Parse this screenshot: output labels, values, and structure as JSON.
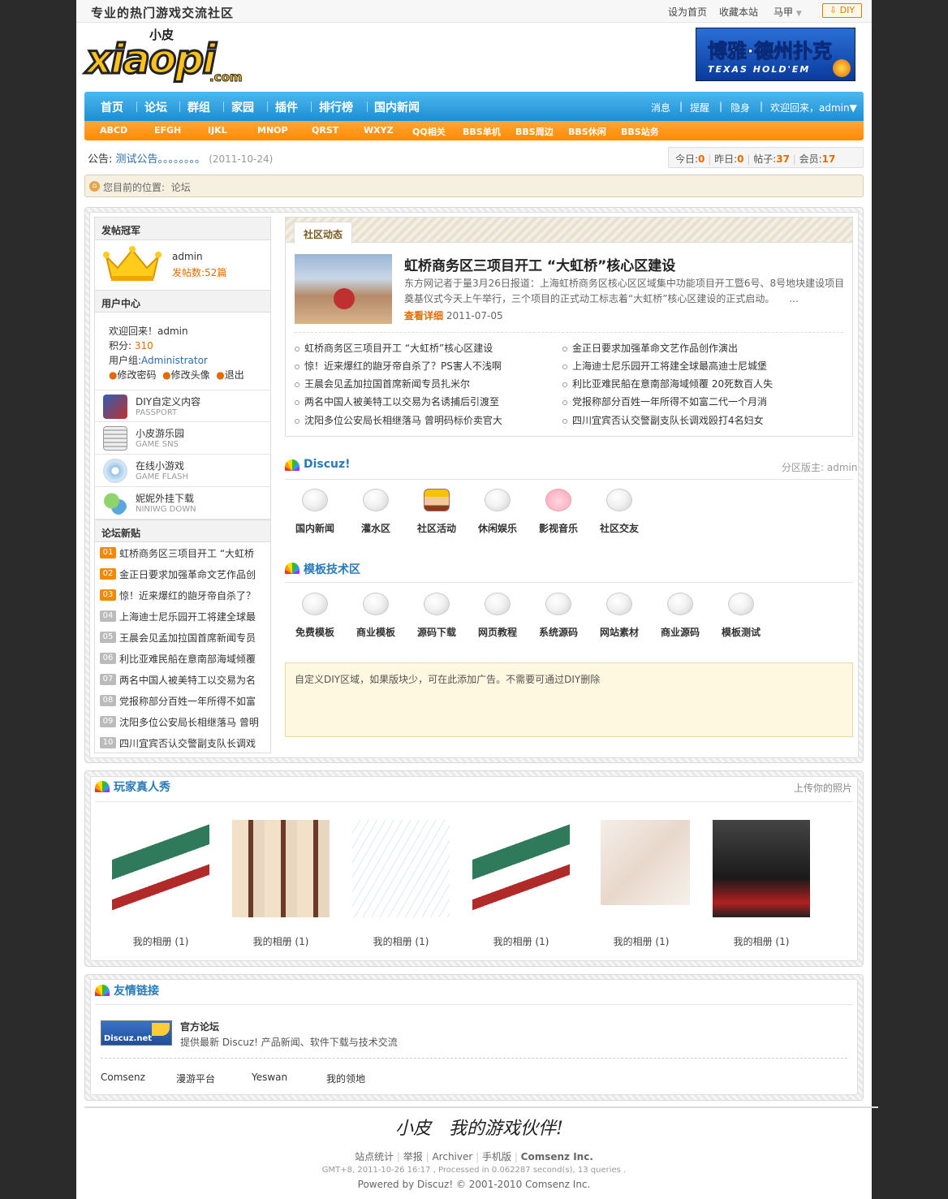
{
  "topbar": {
    "slogan": "专业的热门游戏交流社区",
    "set_home": "设为首页",
    "bookmark": "收藏本站",
    "user": "马甲",
    "diy": "DIY"
  },
  "logo": {
    "text_cn": "小皮",
    "text": "xiaopi",
    "dotcom": ".com"
  },
  "banner": {
    "title": "博雅·德州扑克",
    "sub": "TEXAS HOLD'EM"
  },
  "nav": {
    "items": [
      "首页",
      "论坛",
      "群组",
      "家园",
      "插件",
      "排行榜",
      "国内新闻"
    ],
    "right": [
      "消息",
      "提醒",
      "隐身",
      "欢迎回来，admin▼"
    ]
  },
  "subnav": [
    "ABCD",
    "EFGH",
    "IJKL",
    "MNOP",
    "QRST",
    "WXYZ",
    "QQ相关",
    "BBS单机",
    "BBS周边",
    "BBS休闲",
    "BBS站务"
  ],
  "notice": {
    "label": "公告:",
    "text": "测试公告。。。。。。。。",
    "date": "(2011-10-24)"
  },
  "stats": {
    "today_label": "今日:",
    "today": "0",
    "yesterday_label": "昨日:",
    "yesterday": "0",
    "posts_label": "帖子:",
    "posts": "37",
    "members_label": "会员:",
    "members": "17"
  },
  "breadcrumb": {
    "text": "您目前的位置:",
    "current": "论坛"
  },
  "sidebar": {
    "champion_title": "发帖冠军",
    "champion_name": "admin",
    "champion_count": "发帖数:52篇",
    "usercenter_title": "用户中心",
    "welcome": "欢迎回来！admin",
    "points_label": "积分:",
    "points": "310",
    "group_label": "用户组:",
    "group": "Administrator",
    "links": [
      "修改密码",
      "修改头像",
      "退出"
    ],
    "apps": [
      {
        "title": "DIY自定义内容",
        "sub": "PASSPORT"
      },
      {
        "title": "小皮游乐园",
        "sub": "GAME SNS"
      },
      {
        "title": "在线小游戏",
        "sub": "GAME FLASH"
      },
      {
        "title": "妮妮外挂下载",
        "sub": "NINIWG DOWN"
      }
    ],
    "newposts_title": "论坛新贴",
    "posts": [
      {
        "num": "01",
        "title": "虹桥商务区三项目开工 “大虹桥"
      },
      {
        "num": "02",
        "title": "金正日要求加强革命文艺作品创"
      },
      {
        "num": "03",
        "title": "惊！近来爆红的龅牙帝自杀了？"
      },
      {
        "num": "04",
        "title": "上海迪士尼乐园开工将建全球最"
      },
      {
        "num": "05",
        "title": "王晨会见孟加拉国首席新闻专员"
      },
      {
        "num": "06",
        "title": "利比亚难民船在意南部海域倾覆"
      },
      {
        "num": "07",
        "title": "两名中国人被美特工以交易为名"
      },
      {
        "num": "08",
        "title": "党报称部分百姓一年所得不如富"
      },
      {
        "num": "09",
        "title": "沈阳多位公安局长相继落马 曾明"
      },
      {
        "num": "10",
        "title": "四川宜宾否认交警副支队长调戏"
      }
    ]
  },
  "community": {
    "tab": "社区动态",
    "headline": "虹桥商务区三项目开工 “大虹桥”核心区建设",
    "desc": "东方网记者于量3月26日报道：上海虹桥商务区核心区区域集中功能项目开工暨6号、8号地块建设项目奠基仪式今天上午举行，三个项目的正式动工标志着“大虹桥”核心区建设的正式启动。　　...",
    "more": "查看详细",
    "date": "2011-07-05",
    "news_left": [
      "虹桥商务区三项目开工 “大虹桥”核心区建设",
      "惊！近来爆红的龅牙帝自杀了？PS害人不浅啊",
      "王晨会见孟加拉国首席新闻专员扎米尔",
      "两名中国人被美特工以交易为名诱捕后引渡至",
      "沈阳多位公安局长相继落马 曾明码标价卖官大"
    ],
    "news_right": [
      "金正日要求加强革命文艺作品创作演出",
      "上海迪士尼乐园开工将建全球最高迪士尼城堡",
      "利比亚难民船在意南部海域倾覆 20死数百人失",
      "党报称部分百姓一年所得不如富二代一个月消",
      "四川宜宾否认交警副支队长调戏殴打4名妇女"
    ]
  },
  "discuz": {
    "title": "Discuz!",
    "moderator": "分区版主: admin",
    "forums": [
      "国内新闻",
      "灌水区",
      "社区活动",
      "休闲娱乐",
      "影视音乐",
      "社区交友"
    ]
  },
  "template": {
    "title": "模板技术区",
    "forums": [
      "免费模板",
      "商业模板",
      "源码下载",
      "网页教程",
      "系统源码",
      "网站素材",
      "商业源码",
      "模板测试"
    ]
  },
  "diy_area": {
    "text": "自定义DIY区域，如果版块少，可在此添加广告。不需要可通过DIY删除"
  },
  "photos": {
    "title": "玩家真人秀",
    "upload": "上传你的照片",
    "captions": [
      "我的相册 (1)",
      "我的相册 (1)",
      "我的相册 (1)",
      "我的相册 (1)",
      "我的相册 (1)",
      "我的相册 (1)"
    ]
  },
  "links": {
    "title": "友情链接",
    "logo_text": "Discuz.net",
    "site_name": "官方论坛",
    "site_desc": "提供最新 Discuz! 产品新闻、软件下载与技术交流",
    "text_links": [
      "Comsenz",
      "漫游平台",
      "Yeswan",
      "我的领地"
    ]
  },
  "footer": {
    "slogan": "小皮　我的游戏伙伴!",
    "links": [
      "站点统计",
      "举报",
      "Archiver",
      "手机版",
      "Comsenz Inc."
    ],
    "info": "GMT+8, 2011-10-26 16:17 , Processed in 0.062287 second(s), 13 queries .",
    "powered": "Powered by Discuz! © 2001-2010 Comsenz Inc."
  },
  "colors": {
    "nav_blue": "#1b8ed3",
    "sub_orange": "#ff8a00",
    "accent_orange": "#e46a00",
    "link_blue": "#2a7ab8",
    "page_bg": "#2b2b2b"
  }
}
